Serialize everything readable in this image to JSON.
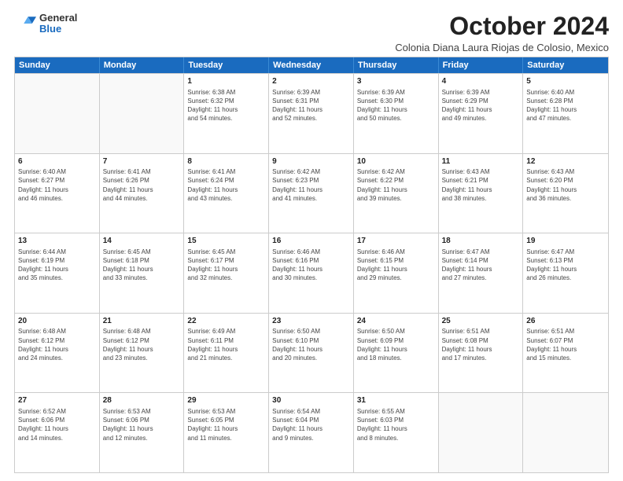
{
  "header": {
    "logo": {
      "general": "General",
      "blue": "Blue"
    },
    "title": "October 2024",
    "location": "Colonia Diana Laura Riojas de Colosio, Mexico"
  },
  "weekdays": [
    "Sunday",
    "Monday",
    "Tuesday",
    "Wednesday",
    "Thursday",
    "Friday",
    "Saturday"
  ],
  "weeks": [
    [
      {
        "day": "",
        "info": ""
      },
      {
        "day": "",
        "info": ""
      },
      {
        "day": "1",
        "info": "Sunrise: 6:38 AM\nSunset: 6:32 PM\nDaylight: 11 hours\nand 54 minutes."
      },
      {
        "day": "2",
        "info": "Sunrise: 6:39 AM\nSunset: 6:31 PM\nDaylight: 11 hours\nand 52 minutes."
      },
      {
        "day": "3",
        "info": "Sunrise: 6:39 AM\nSunset: 6:30 PM\nDaylight: 11 hours\nand 50 minutes."
      },
      {
        "day": "4",
        "info": "Sunrise: 6:39 AM\nSunset: 6:29 PM\nDaylight: 11 hours\nand 49 minutes."
      },
      {
        "day": "5",
        "info": "Sunrise: 6:40 AM\nSunset: 6:28 PM\nDaylight: 11 hours\nand 47 minutes."
      }
    ],
    [
      {
        "day": "6",
        "info": "Sunrise: 6:40 AM\nSunset: 6:27 PM\nDaylight: 11 hours\nand 46 minutes."
      },
      {
        "day": "7",
        "info": "Sunrise: 6:41 AM\nSunset: 6:26 PM\nDaylight: 11 hours\nand 44 minutes."
      },
      {
        "day": "8",
        "info": "Sunrise: 6:41 AM\nSunset: 6:24 PM\nDaylight: 11 hours\nand 43 minutes."
      },
      {
        "day": "9",
        "info": "Sunrise: 6:42 AM\nSunset: 6:23 PM\nDaylight: 11 hours\nand 41 minutes."
      },
      {
        "day": "10",
        "info": "Sunrise: 6:42 AM\nSunset: 6:22 PM\nDaylight: 11 hours\nand 39 minutes."
      },
      {
        "day": "11",
        "info": "Sunrise: 6:43 AM\nSunset: 6:21 PM\nDaylight: 11 hours\nand 38 minutes."
      },
      {
        "day": "12",
        "info": "Sunrise: 6:43 AM\nSunset: 6:20 PM\nDaylight: 11 hours\nand 36 minutes."
      }
    ],
    [
      {
        "day": "13",
        "info": "Sunrise: 6:44 AM\nSunset: 6:19 PM\nDaylight: 11 hours\nand 35 minutes."
      },
      {
        "day": "14",
        "info": "Sunrise: 6:45 AM\nSunset: 6:18 PM\nDaylight: 11 hours\nand 33 minutes."
      },
      {
        "day": "15",
        "info": "Sunrise: 6:45 AM\nSunset: 6:17 PM\nDaylight: 11 hours\nand 32 minutes."
      },
      {
        "day": "16",
        "info": "Sunrise: 6:46 AM\nSunset: 6:16 PM\nDaylight: 11 hours\nand 30 minutes."
      },
      {
        "day": "17",
        "info": "Sunrise: 6:46 AM\nSunset: 6:15 PM\nDaylight: 11 hours\nand 29 minutes."
      },
      {
        "day": "18",
        "info": "Sunrise: 6:47 AM\nSunset: 6:14 PM\nDaylight: 11 hours\nand 27 minutes."
      },
      {
        "day": "19",
        "info": "Sunrise: 6:47 AM\nSunset: 6:13 PM\nDaylight: 11 hours\nand 26 minutes."
      }
    ],
    [
      {
        "day": "20",
        "info": "Sunrise: 6:48 AM\nSunset: 6:12 PM\nDaylight: 11 hours\nand 24 minutes."
      },
      {
        "day": "21",
        "info": "Sunrise: 6:48 AM\nSunset: 6:12 PM\nDaylight: 11 hours\nand 23 minutes."
      },
      {
        "day": "22",
        "info": "Sunrise: 6:49 AM\nSunset: 6:11 PM\nDaylight: 11 hours\nand 21 minutes."
      },
      {
        "day": "23",
        "info": "Sunrise: 6:50 AM\nSunset: 6:10 PM\nDaylight: 11 hours\nand 20 minutes."
      },
      {
        "day": "24",
        "info": "Sunrise: 6:50 AM\nSunset: 6:09 PM\nDaylight: 11 hours\nand 18 minutes."
      },
      {
        "day": "25",
        "info": "Sunrise: 6:51 AM\nSunset: 6:08 PM\nDaylight: 11 hours\nand 17 minutes."
      },
      {
        "day": "26",
        "info": "Sunrise: 6:51 AM\nSunset: 6:07 PM\nDaylight: 11 hours\nand 15 minutes."
      }
    ],
    [
      {
        "day": "27",
        "info": "Sunrise: 6:52 AM\nSunset: 6:06 PM\nDaylight: 11 hours\nand 14 minutes."
      },
      {
        "day": "28",
        "info": "Sunrise: 6:53 AM\nSunset: 6:06 PM\nDaylight: 11 hours\nand 12 minutes."
      },
      {
        "day": "29",
        "info": "Sunrise: 6:53 AM\nSunset: 6:05 PM\nDaylight: 11 hours\nand 11 minutes."
      },
      {
        "day": "30",
        "info": "Sunrise: 6:54 AM\nSunset: 6:04 PM\nDaylight: 11 hours\nand 9 minutes."
      },
      {
        "day": "31",
        "info": "Sunrise: 6:55 AM\nSunset: 6:03 PM\nDaylight: 11 hours\nand 8 minutes."
      },
      {
        "day": "",
        "info": ""
      },
      {
        "day": "",
        "info": ""
      }
    ]
  ]
}
